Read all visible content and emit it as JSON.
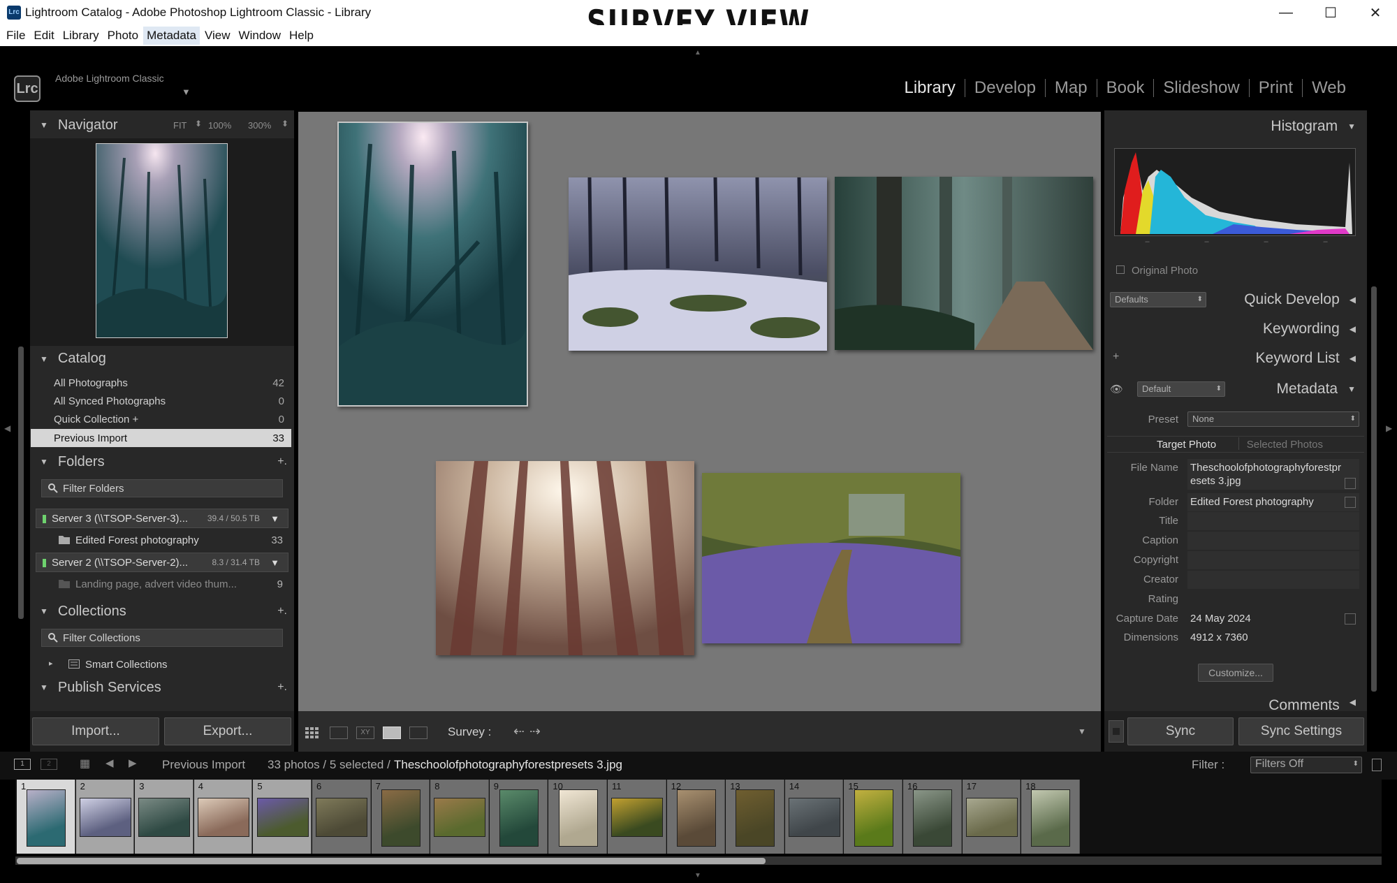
{
  "window": {
    "title": "Lightroom Catalog - Adobe Photoshop Lightroom Classic - Library",
    "icon_text": "Lrc",
    "overlay_title": "SURVEY VIEW",
    "controls": {
      "minimize": "—",
      "maximize": "☐",
      "close": "✕"
    }
  },
  "menu": [
    "File",
    "Edit",
    "Library",
    "Photo",
    "Metadata",
    "View",
    "Window",
    "Help"
  ],
  "identity": {
    "logo": "Lrc",
    "name": "Adobe Lightroom Classic",
    "arrow": "▼"
  },
  "modules": [
    "Library",
    "Develop",
    "Map",
    "Book",
    "Slideshow",
    "Print",
    "Web"
  ],
  "navigator": {
    "title": "Navigator",
    "fit": "FIT",
    "z1": "100%",
    "z2": "300%"
  },
  "catalog": {
    "title": "Catalog",
    "items": [
      {
        "label": "All Photographs",
        "count": "42"
      },
      {
        "label": "All Synced Photographs",
        "count": "0"
      },
      {
        "label": "Quick Collection  +",
        "count": "0"
      },
      {
        "label": "Previous Import",
        "count": "33"
      }
    ]
  },
  "folders": {
    "title": "Folders",
    "plus": "+.",
    "filter": "Filter Folders",
    "volumes": [
      {
        "name": "Server 3 (\\\\TSOP-Server-3)...",
        "usage": "39.4 / 50.5 TB"
      },
      {
        "name": "Server 2 (\\\\TSOP-Server-2)...",
        "usage": "8.3 / 31.4 TB"
      }
    ],
    "items": [
      {
        "label": "Edited Forest photography",
        "count": "33"
      },
      {
        "label": "Landing page, advert video thum...",
        "count": "9"
      }
    ]
  },
  "collections": {
    "title": "Collections",
    "plus": "+.",
    "filter": "Filter Collections",
    "smart": "Smart Collections"
  },
  "publish": {
    "title": "Publish Services",
    "plus": "+."
  },
  "buttons": {
    "import": "Import...",
    "export": "Export...",
    "sync": "Sync",
    "sync_settings": "Sync Settings"
  },
  "toolbar": {
    "survey": "Survey :"
  },
  "histogram": {
    "title": "Histogram",
    "original": "Original Photo"
  },
  "quick_develop": {
    "title": "Quick Develop",
    "preset": "Defaults"
  },
  "keywording": {
    "title": "Keywording"
  },
  "keyword_list": {
    "title": "Keyword List"
  },
  "metadata": {
    "title": "Metadata",
    "preset_select": "Default",
    "preset_label": "Preset",
    "preset_value": "None",
    "tab_target": "Target Photo",
    "tab_selected": "Selected Photos",
    "fields": {
      "file_name_label": "File Name",
      "file_name": "Theschoolofphotographyforestpr esets 3.jpg",
      "folder_label": "Folder",
      "folder": "Edited Forest photography",
      "title_label": "Title",
      "caption_label": "Caption",
      "copyright_label": "Copyright",
      "creator_label": "Creator",
      "rating_label": "Rating",
      "capture_label": "Capture Date",
      "capture": "24 May 2024",
      "dimensions_label": "Dimensions",
      "dimensions": "4912 x 7360"
    },
    "customize": "Customize..."
  },
  "comments": {
    "title": "Comments"
  },
  "filmstrip_bar": {
    "source": "Previous Import",
    "status": "33 photos / 5 selected /",
    "file": "Theschoolofphotographyforestpresets 3.jpg",
    "filter_label": "Filter :",
    "filter_value": "Filters Off"
  },
  "filmstrip": [
    "1",
    "2",
    "3",
    "4",
    "5",
    "6",
    "7",
    "8",
    "9",
    "10",
    "11",
    "12",
    "13",
    "14",
    "15",
    "16",
    "17",
    "18"
  ],
  "colors": {
    "accent": "#d6d6d6",
    "panel": "#282828",
    "canvas": "#777777"
  }
}
